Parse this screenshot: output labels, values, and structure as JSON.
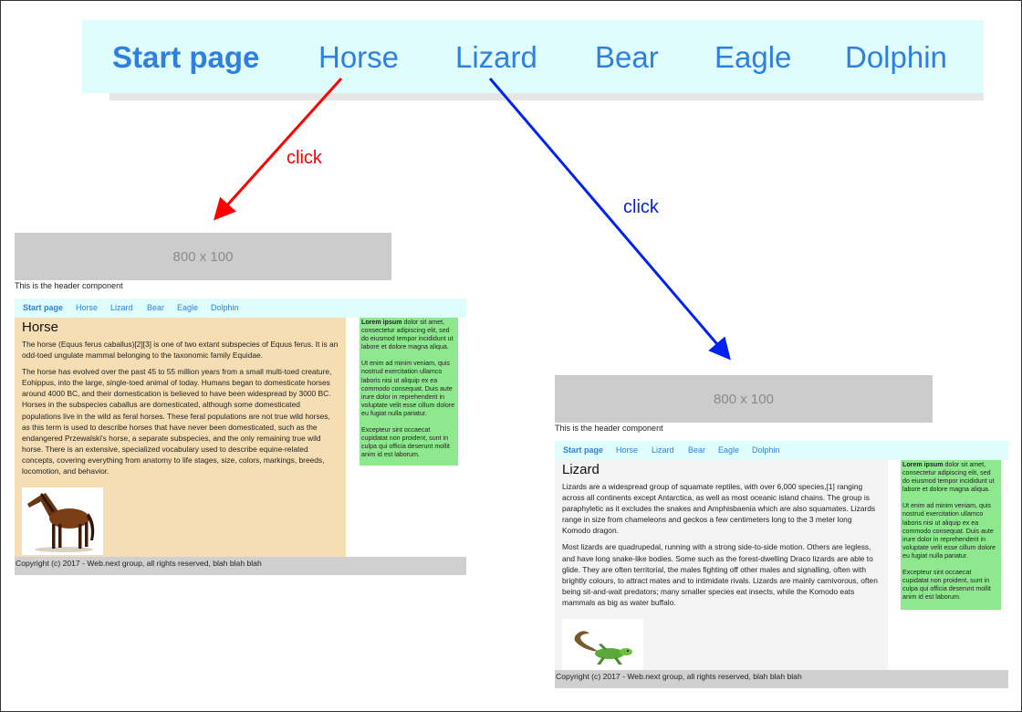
{
  "big_nav": {
    "items": [
      "Start page",
      "Horse",
      "Lizard",
      "Bear",
      "Eagle",
      "Dolphin"
    ],
    "active_index": 0
  },
  "annotations": {
    "left_click_label": "click",
    "right_click_label": "click",
    "left_color": "#ff0000",
    "right_color": "#0022ee"
  },
  "horse_page": {
    "banner_text": "800 x 100",
    "header_caption": "This is the header component",
    "nav": [
      "Start page",
      "Horse",
      "Lizard",
      "Bear",
      "Eagle",
      "Dolphin"
    ],
    "title": "Horse",
    "paragraphs": [
      "The horse (Equus ferus caballus)[2][3] is one of two extant subspecies of Equus ferus. It is an odd-toed ungulate mammal belonging to the taxonomic family Equidae.",
      "The horse has evolved over the past 45 to 55 million years from a small multi-toed creature, Eohippus, into the large, single-toed animal of today. Humans began to domesticate horses around 4000 BC, and their domestication is believed to have been widespread by 3000 BC. Horses in the subspecies caballus are domesticated, although some domesticated populations live in the wild as feral horses. These feral populations are not true wild horses, as this term is used to describe horses that have never been domesticated, such as the endangered Przewalski's horse, a separate subspecies, and the only remaining true wild horse. There is an extensive, specialized vocabulary used to describe equine-related concepts, covering everything from anatomy to life stages, size, colors, markings, breeds, locomotion, and behavior."
    ],
    "content_bg": "#f5deb3",
    "footer": "Copyright (c) 2017 - Web.next group, all rights reserved, blah blah blah"
  },
  "lizard_page": {
    "banner_text": "800 x 100",
    "header_caption": "This is the header component",
    "nav": [
      "Start page",
      "Horse",
      "Lizard",
      "Bear",
      "Eagle",
      "Dolphin"
    ],
    "title": "Lizard",
    "paragraphs": [
      "Lizards are a widespread group of squamate reptiles, with over 6,000 species,[1] ranging across all continents except Antarctica, as well as most oceanic island chains. The group is paraphyletic as it excludes the snakes and Amphisbaenia which are also squamates. Lizards range in size from chameleons and geckos a few centimeters long to the 3 meter long Komodo dragon.",
      "Most lizards are quadrupedal, running with a strong side-to-side motion. Others are legless, and have long snake-like bodies. Some such as the forest-dwelling Draco lizards are able to glide. They are often territorial, the males fighting off other males and signalling, often with brightly colours, to attract mates and to intimidate rivals. Lizards are mainly carnivorous, often being sit-and-wait predators; many smaller species eat insects, while the Komodo eats mammals as big as water buffalo."
    ],
    "content_bg": "#f3f3f3",
    "footer": "Copyright (c) 2017 - Web.next group, all rights reserved, blah blah blah"
  },
  "sidebar": {
    "lead_bold": "Lorem ipsum",
    "lead_rest": " dolor sit amet, consectetur adipiscing elit, sed do eiusmod tempor incididunt ut labore et dolore magna aliqua.",
    "p2": "Ut enim ad minim veniam, quis nostrud exercitation ullamco laboris nisi ut aliquip ex ea commodo consequat. Duis aute irure dolor in reprehenderit in voluptate velit esse cillum dolore eu fugiat nulla pariatur.",
    "p3": "Excepteur sint occaecat cupidatat non proident, sunt in culpa qui officia deserunt mollit anim id est laborum."
  }
}
